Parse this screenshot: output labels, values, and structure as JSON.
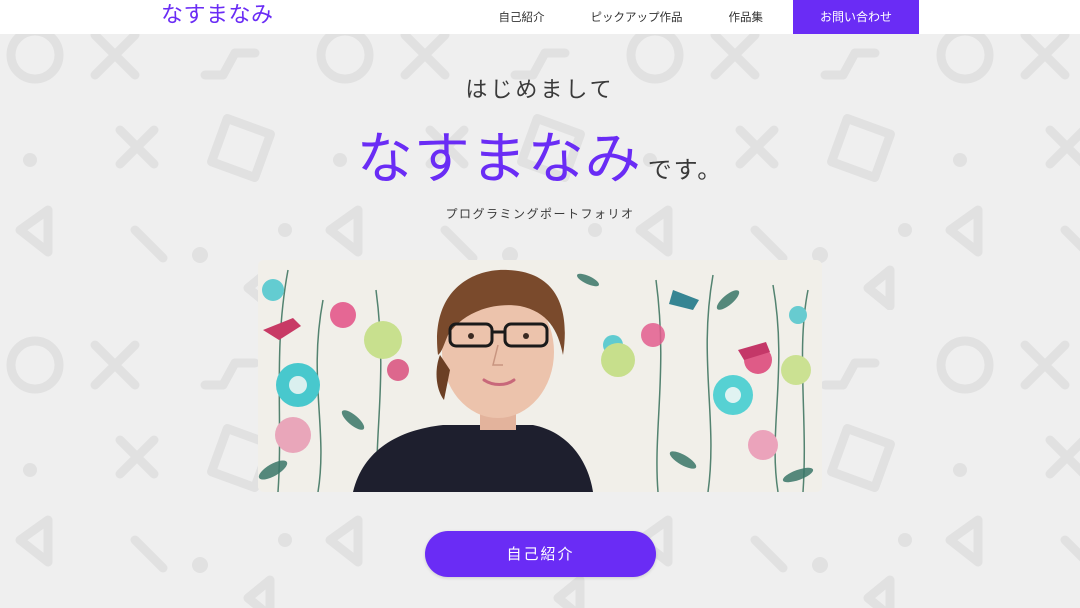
{
  "header": {
    "logo": "なすまなみ",
    "nav": {
      "about": "自己紹介",
      "pickup": "ピックアップ作品",
      "works": "作品集",
      "contact": "お問い合わせ"
    }
  },
  "hero": {
    "greeting": "はじめまして",
    "name": "なすまなみ",
    "name_suffix": "です。",
    "subtitle": "プログラミングポートフォリオ",
    "cta_label": "自己紹介",
    "photo_icon": "portrait-photo"
  },
  "colors": {
    "accent": "#6a2cf5",
    "background": "#efefef",
    "header_bg": "#ffffff",
    "text": "#333333",
    "pattern": "#e2e2e2"
  }
}
